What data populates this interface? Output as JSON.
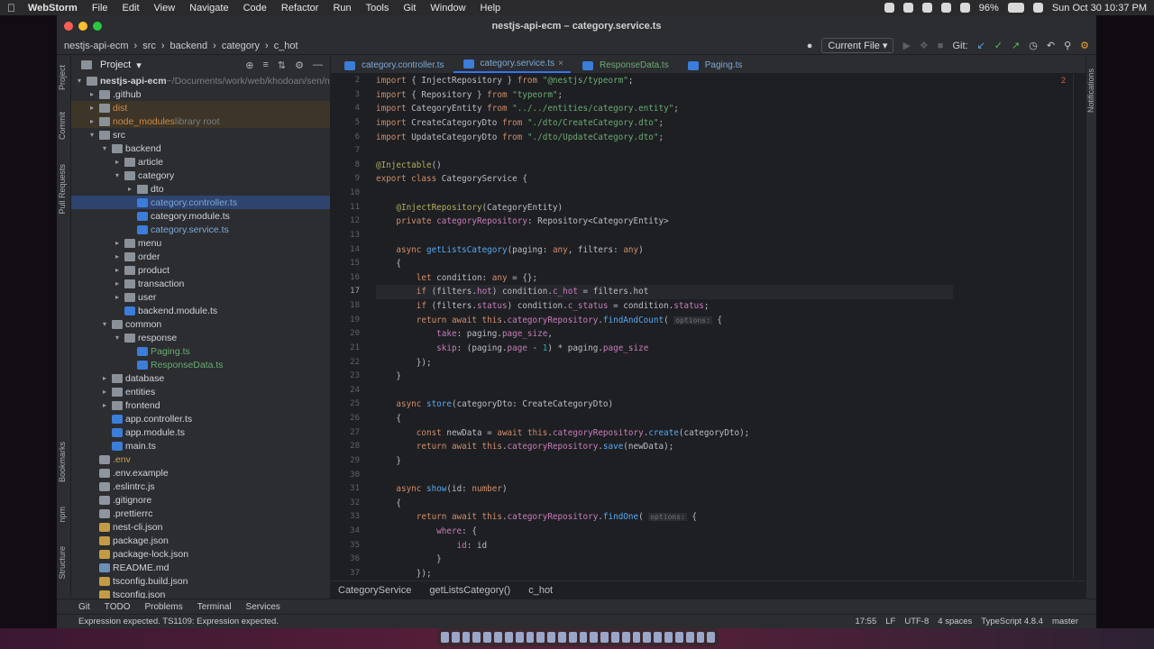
{
  "macbar": {
    "app": "WebStorm",
    "menus": [
      "File",
      "Edit",
      "View",
      "Navigate",
      "Code",
      "Refactor",
      "Run",
      "Tools",
      "Git",
      "Window",
      "Help"
    ],
    "battery": "96%",
    "datetime": "Sun Oct 30  10:37 PM"
  },
  "window": {
    "title": "nestjs-api-ecm – category.service.ts"
  },
  "navbar": {
    "crumbs": [
      "nestjs-api-ecm",
      "src",
      "backend",
      "category",
      "c_hot"
    ],
    "run_config": "Current File",
    "git_label": "Git:"
  },
  "left_strip": {
    "labels": [
      "Project",
      "Commit",
      "Pull Requests",
      "Bookmarks",
      "npm",
      "Structure"
    ]
  },
  "project": {
    "title": "Project",
    "tree": [
      {
        "d": 0,
        "a": "▾",
        "i": "folder",
        "t": "nestjs-api-ecm",
        "x": " ~/Documents/work/web/khodoan/sen/n",
        "bold": true
      },
      {
        "d": 1,
        "a": "▸",
        "i": "folder",
        "t": ".github"
      },
      {
        "d": 1,
        "a": "▸",
        "i": "folder",
        "t": "dist",
        "cls": "excluded",
        "color": "#d08a45"
      },
      {
        "d": 1,
        "a": "▸",
        "i": "folder",
        "t": "node_modules",
        "x": " library root",
        "cls": "excluded",
        "color": "#d08a45"
      },
      {
        "d": 1,
        "a": "▾",
        "i": "folder",
        "t": "src"
      },
      {
        "d": 2,
        "a": "▾",
        "i": "folder",
        "t": "backend"
      },
      {
        "d": 3,
        "a": "▸",
        "i": "folder",
        "t": "article"
      },
      {
        "d": 3,
        "a": "▾",
        "i": "folder",
        "t": "category"
      },
      {
        "d": 4,
        "a": "▸",
        "i": "folder",
        "t": "dto"
      },
      {
        "d": 4,
        "a": "",
        "i": "file-ts",
        "t": "category.controller.ts",
        "cls": "selected",
        "color": "#7fa8d8"
      },
      {
        "d": 4,
        "a": "",
        "i": "file-ts",
        "t": "category.module.ts"
      },
      {
        "d": 4,
        "a": "",
        "i": "file-ts",
        "t": "category.service.ts",
        "color": "#7fa8d8"
      },
      {
        "d": 3,
        "a": "▸",
        "i": "folder",
        "t": "menu"
      },
      {
        "d": 3,
        "a": "▸",
        "i": "folder",
        "t": "order"
      },
      {
        "d": 3,
        "a": "▸",
        "i": "folder",
        "t": "product"
      },
      {
        "d": 3,
        "a": "▸",
        "i": "folder",
        "t": "transaction"
      },
      {
        "d": 3,
        "a": "▸",
        "i": "folder",
        "t": "user"
      },
      {
        "d": 3,
        "a": "",
        "i": "file-ts",
        "t": "backend.module.ts"
      },
      {
        "d": 2,
        "a": "▾",
        "i": "folder",
        "t": "common"
      },
      {
        "d": 3,
        "a": "▾",
        "i": "folder",
        "t": "response"
      },
      {
        "d": 4,
        "a": "",
        "i": "file-ts",
        "t": "Paging.ts",
        "color": "#6aab73"
      },
      {
        "d": 4,
        "a": "",
        "i": "file-ts",
        "t": "ResponseData.ts",
        "color": "#6aab73"
      },
      {
        "d": 2,
        "a": "▸",
        "i": "folder",
        "t": "database"
      },
      {
        "d": 2,
        "a": "▸",
        "i": "folder",
        "t": "entities"
      },
      {
        "d": 2,
        "a": "▸",
        "i": "folder",
        "t": "frontend"
      },
      {
        "d": 2,
        "a": "",
        "i": "file-ts",
        "t": "app.controller.ts"
      },
      {
        "d": 2,
        "a": "",
        "i": "file-ts",
        "t": "app.module.ts"
      },
      {
        "d": 2,
        "a": "",
        "i": "file-ts",
        "t": "main.ts"
      },
      {
        "d": 1,
        "a": "",
        "i": "file-gen",
        "t": ".env",
        "color": "#c9a55a"
      },
      {
        "d": 1,
        "a": "",
        "i": "file-gen",
        "t": ".env.example"
      },
      {
        "d": 1,
        "a": "",
        "i": "file-gen",
        "t": ".eslintrc.js"
      },
      {
        "d": 1,
        "a": "",
        "i": "file-gen",
        "t": ".gitignore"
      },
      {
        "d": 1,
        "a": "",
        "i": "file-gen",
        "t": ".prettierrc"
      },
      {
        "d": 1,
        "a": "",
        "i": "file-json",
        "t": "nest-cli.json"
      },
      {
        "d": 1,
        "a": "",
        "i": "file-json",
        "t": "package.json"
      },
      {
        "d": 1,
        "a": "",
        "i": "file-json",
        "t": "package-lock.json"
      },
      {
        "d": 1,
        "a": "",
        "i": "file-md",
        "t": "README.md"
      },
      {
        "d": 1,
        "a": "",
        "i": "file-json",
        "t": "tsconfig.build.json"
      },
      {
        "d": 1,
        "a": "",
        "i": "file-json",
        "t": "tsconfig.json"
      }
    ]
  },
  "editor": {
    "tabs": [
      {
        "t": "category.controller.ts"
      },
      {
        "t": "category.service.ts",
        "active": true
      },
      {
        "t": "ResponseData.ts",
        "color": "#6aab73"
      },
      {
        "t": "Paging.ts",
        "color": "#7fa8d8"
      }
    ],
    "warnings": "2",
    "current_line": 17,
    "lines": [
      {
        "n": "2",
        "c": "<span class=kw>import</span> { InjectRepository } <span class=kw>from</span> <span class=str>\"@nestjs/typeorm\"</span>;"
      },
      {
        "n": "3",
        "c": "<span class=kw>import</span> { Repository } <span class=kw>from</span> <span class=str>\"typeorm\"</span>;"
      },
      {
        "n": "4",
        "c": "<span class=kw>import</span> CategoryEntity <span class=kw>from</span> <span class=str>\"../../entities/category.entity\"</span>;"
      },
      {
        "n": "5",
        "c": "<span class=kw>import</span> CreateCategoryDto <span class=kw>from</span> <span class=str>\"./dto/CreateCategory.dto\"</span>;"
      },
      {
        "n": "6",
        "c": "<span class=kw>import</span> UpdateCategoryDto <span class=kw>from</span> <span class=str>\"./dto/UpdateCategory.dto\"</span>;"
      },
      {
        "n": "7",
        "c": ""
      },
      {
        "n": "8",
        "c": "<span class=dec>@Injectable</span>()"
      },
      {
        "n": "9",
        "c": "<span class=kw>export class</span> CategoryService {"
      },
      {
        "n": "10",
        "c": ""
      },
      {
        "n": "11",
        "c": "    <span class=dec>@InjectRepository</span>(CategoryEntity)"
      },
      {
        "n": "12",
        "c": "    <span class=kw>private</span> <span class=prop>categoryRepository</span>: Repository&lt;CategoryEntity&gt;"
      },
      {
        "n": "13",
        "c": ""
      },
      {
        "n": "14",
        "c": "    <span class=kw>async</span> <span class=fn>getListsCategory</span>(paging: <span class=kw>any</span>, filters: <span class=kw>any</span>)"
      },
      {
        "n": "15",
        "c": "    {"
      },
      {
        "n": "16",
        "c": "        <span class=kw>let</span> condition: <span class=kw>any</span> = {};"
      },
      {
        "n": "17",
        "c": "        <span class=kw>if</span> (filters.<span class=prop>hot</span>) condition.<span class=prop>c_hot</span> = filters.hot"
      },
      {
        "n": "18",
        "c": "        <span class=kw>if</span> (filters.<span class=prop>status</span>) condition.<span class=prop>c_status</span> = condition.<span class=prop>status</span>;"
      },
      {
        "n": "19",
        "c": "        <span class=kw>return await this</span>.<span class=prop>categoryRepository</span>.<span class=fn>findAndCount</span>( <span class=hint>options:</span> {"
      },
      {
        "n": "20",
        "c": "            <span class=prop>take</span>: paging.<span class=prop>page_size</span>,"
      },
      {
        "n": "21",
        "c": "            <span class=prop>skip</span>: (paging.<span class=prop>page</span> - <span class=num>1</span>) * paging.<span class=prop>page_size</span>"
      },
      {
        "n": "22",
        "c": "        });"
      },
      {
        "n": "23",
        "c": "    }"
      },
      {
        "n": "24",
        "c": ""
      },
      {
        "n": "25",
        "c": "    <span class=kw>async</span> <span class=fn>store</span>(categoryDto: CreateCategoryDto)"
      },
      {
        "n": "26",
        "c": "    {"
      },
      {
        "n": "27",
        "c": "        <span class=kw>const</span> newData = <span class=kw>await this</span>.<span class=prop>categoryRepository</span>.<span class=fn>create</span>(categoryDto);"
      },
      {
        "n": "28",
        "c": "        <span class=kw>return await this</span>.<span class=prop>categoryRepository</span>.<span class=fn>save</span>(newData);"
      },
      {
        "n": "29",
        "c": "    }"
      },
      {
        "n": "30",
        "c": ""
      },
      {
        "n": "31",
        "c": "    <span class=kw>async</span> <span class=fn>show</span>(id: <span class=kw>number</span>)"
      },
      {
        "n": "32",
        "c": "    {"
      },
      {
        "n": "33",
        "c": "        <span class=kw>return await this</span>.<span class=prop>categoryRepository</span>.<span class=fn>findOne</span>( <span class=hint>options:</span> {"
      },
      {
        "n": "34",
        "c": "            <span class=prop>where</span>: {"
      },
      {
        "n": "35",
        "c": "                <span class=prop>id</span>: id"
      },
      {
        "n": "36",
        "c": "            }"
      },
      {
        "n": "37",
        "c": "        });"
      }
    ],
    "breadcrumb": [
      "CategoryService",
      "getListsCategory()",
      "c_hot"
    ]
  },
  "right_strip": {
    "label": "Notifications"
  },
  "toolwindows": [
    "Git",
    "TODO",
    "Problems",
    "Terminal",
    "Services"
  ],
  "status": {
    "message": "Expression expected. TS1109: Expression expected.",
    "pos": "17:55",
    "sep": "LF",
    "enc": "UTF-8",
    "indent": "4 spaces",
    "lang": "TypeScript 4.8.4",
    "branch": "master"
  }
}
